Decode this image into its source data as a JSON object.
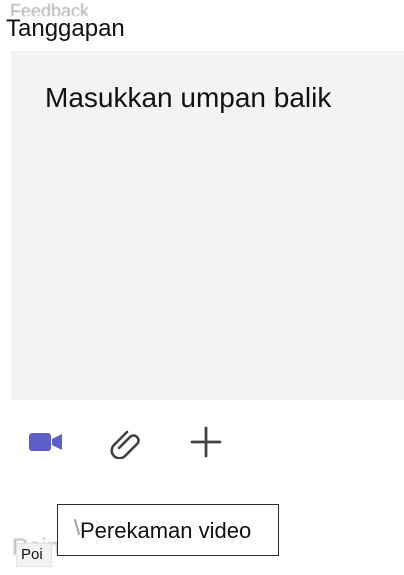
{
  "header": {
    "label": "Tanggapan"
  },
  "feedback": {
    "placeholder": "Masukkan umpan balik"
  },
  "toolbar": {
    "video_icon": "video-camera-icon",
    "attach_icon": "paperclip-icon",
    "add_icon": "plus-icon",
    "video_color": "#5b5fc7",
    "icon_color": "#424242"
  },
  "tooltip": {
    "text": "Perekaman video"
  },
  "footer": {
    "badge_text": "Poi"
  }
}
